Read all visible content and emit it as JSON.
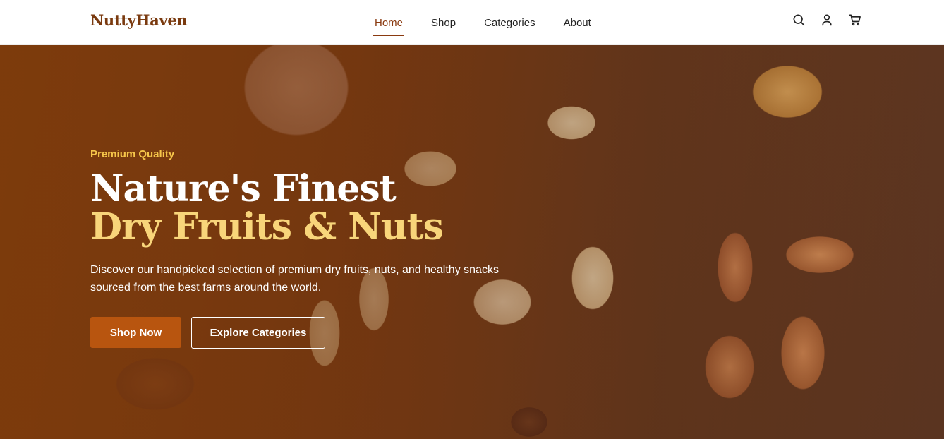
{
  "header": {
    "logo": "NuttyHaven",
    "nav": [
      {
        "label": "Home",
        "active": true
      },
      {
        "label": "Shop",
        "active": false
      },
      {
        "label": "Categories",
        "active": false
      },
      {
        "label": "About",
        "active": false
      }
    ],
    "icons": [
      "search-icon",
      "user-icon",
      "cart-icon"
    ]
  },
  "hero": {
    "eyebrow": "Premium Quality",
    "title_line1": "Nature's Finest",
    "title_line2": "Dry Fruits & Nuts",
    "description": "Discover our handpicked selection of premium dry fruits, nuts, and healthy snacks sourced from the best farms around the world.",
    "primary_button": "Shop Now",
    "secondary_button": "Explore Categories"
  },
  "colors": {
    "brand": "#7a3a0f",
    "accent": "#b8550f",
    "eyebrow": "#f6c64a",
    "highlight_title": "#f8d57a"
  }
}
